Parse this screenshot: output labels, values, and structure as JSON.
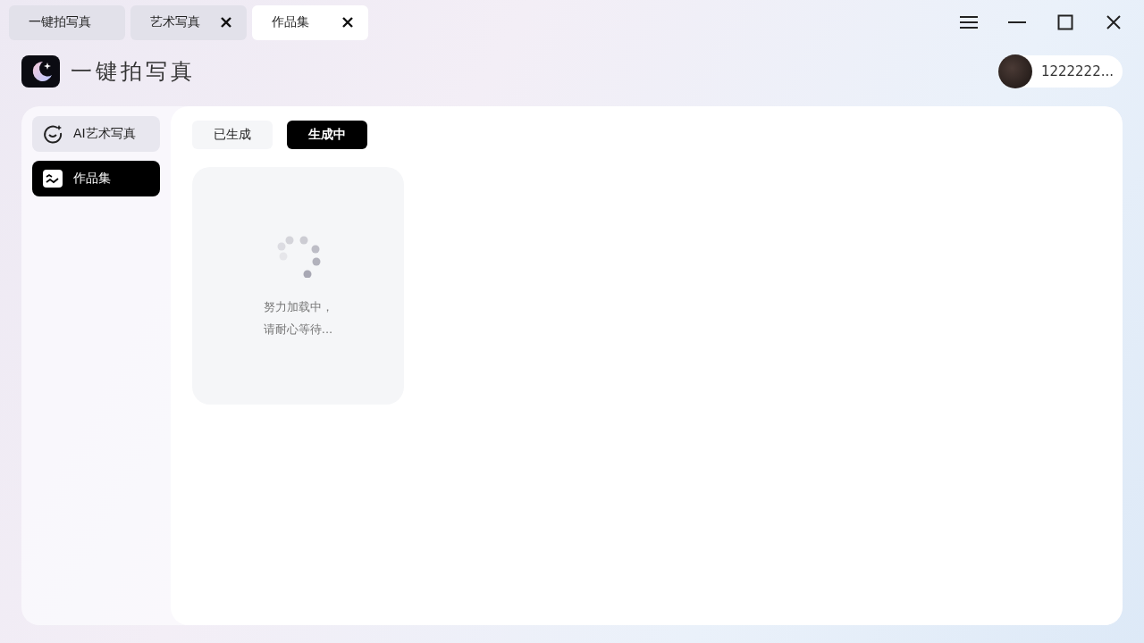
{
  "tabs": [
    {
      "label": "一键拍写真",
      "closable": false,
      "selected": false
    },
    {
      "label": "艺术写真",
      "closable": true,
      "selected": false
    },
    {
      "label": "作品集",
      "closable": true,
      "selected": true
    }
  ],
  "app": {
    "title": "一键拍写真"
  },
  "user": {
    "name": "1222222..."
  },
  "sidebar": {
    "items": [
      {
        "label": "AI艺术写真",
        "kind": "ai",
        "selected": false
      },
      {
        "label": "作品集",
        "kind": "gallery",
        "selected": true
      }
    ]
  },
  "filters": [
    {
      "label": "已生成",
      "selected": false
    },
    {
      "label": "生成中",
      "selected": true
    }
  ],
  "loading_card": {
    "lines": [
      "努力加载中，",
      "请耐心等待..."
    ]
  }
}
